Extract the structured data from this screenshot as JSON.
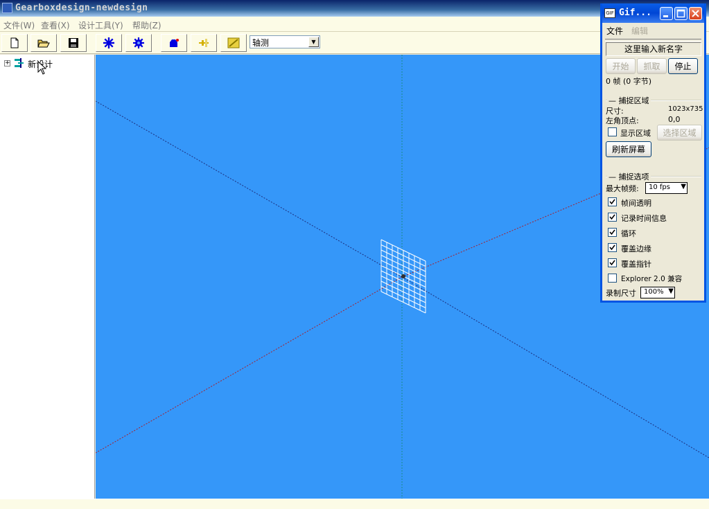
{
  "main_window": {
    "title": "Gearboxdesign-newdesign",
    "menu": [
      {
        "label": "文件(W)"
      },
      {
        "label": "查看(X)"
      },
      {
        "label": "设计工具(Y)"
      },
      {
        "label": "帮助(Z)"
      }
    ],
    "toolbar": {
      "buttons": [
        {
          "icon": "new-file-icon"
        },
        {
          "icon": "open-folder-icon"
        },
        {
          "icon": "save-disk-icon"
        },
        {
          "icon": "gear-star-icon"
        },
        {
          "icon": "gear-wheel-icon"
        },
        {
          "icon": "gearbox-assembly-icon"
        },
        {
          "icon": "shaft-icon"
        },
        {
          "icon": "parts-icon"
        }
      ],
      "view_select": {
        "value": "轴测"
      }
    },
    "tree": {
      "expand_symbol": "+",
      "root_label": "新设计"
    },
    "colors": {
      "viewport_bg": "#3597F9",
      "axis_red": "#A81E2A",
      "axis_navy": "#1C2C7A",
      "axis_teal": "#168E86",
      "grid_white": "#FFFFFF"
    }
  },
  "gif_window": {
    "title": "Gif...",
    "menu": [
      {
        "label": "文件",
        "enabled": true
      },
      {
        "label": "编辑",
        "enabled": false
      }
    ],
    "name_field": "这里输入新名字",
    "buttons": {
      "start": "开始",
      "grab": "抓取",
      "stop": "停止"
    },
    "frame_info": "0 帧 (0 字节)",
    "capture_region": {
      "group_title": "捕捉区域",
      "size_label": "尺寸:",
      "size_value": "1023x735",
      "corner_label": "左角顶点:",
      "corner_value": "0,0",
      "show_region_label": "显示区域",
      "show_region_checked": false,
      "select_region_button": "选择区域",
      "refresh_button": "刷新屏幕"
    },
    "capture_options": {
      "group_title": "捕捉选项",
      "max_fps_label": "最大帧频:",
      "max_fps_value": "10 fps",
      "options": [
        {
          "label": "帧间透明",
          "checked": true
        },
        {
          "label": "记录时间信息",
          "checked": true
        },
        {
          "label": "循环",
          "checked": true
        },
        {
          "label": "覆盖边缘",
          "checked": true
        },
        {
          "label": "覆盖指针",
          "checked": true
        },
        {
          "label": "Explorer 2.0 兼容",
          "checked": false
        }
      ],
      "record_size_label": "录制尺寸",
      "record_size_value": "100%"
    }
  }
}
